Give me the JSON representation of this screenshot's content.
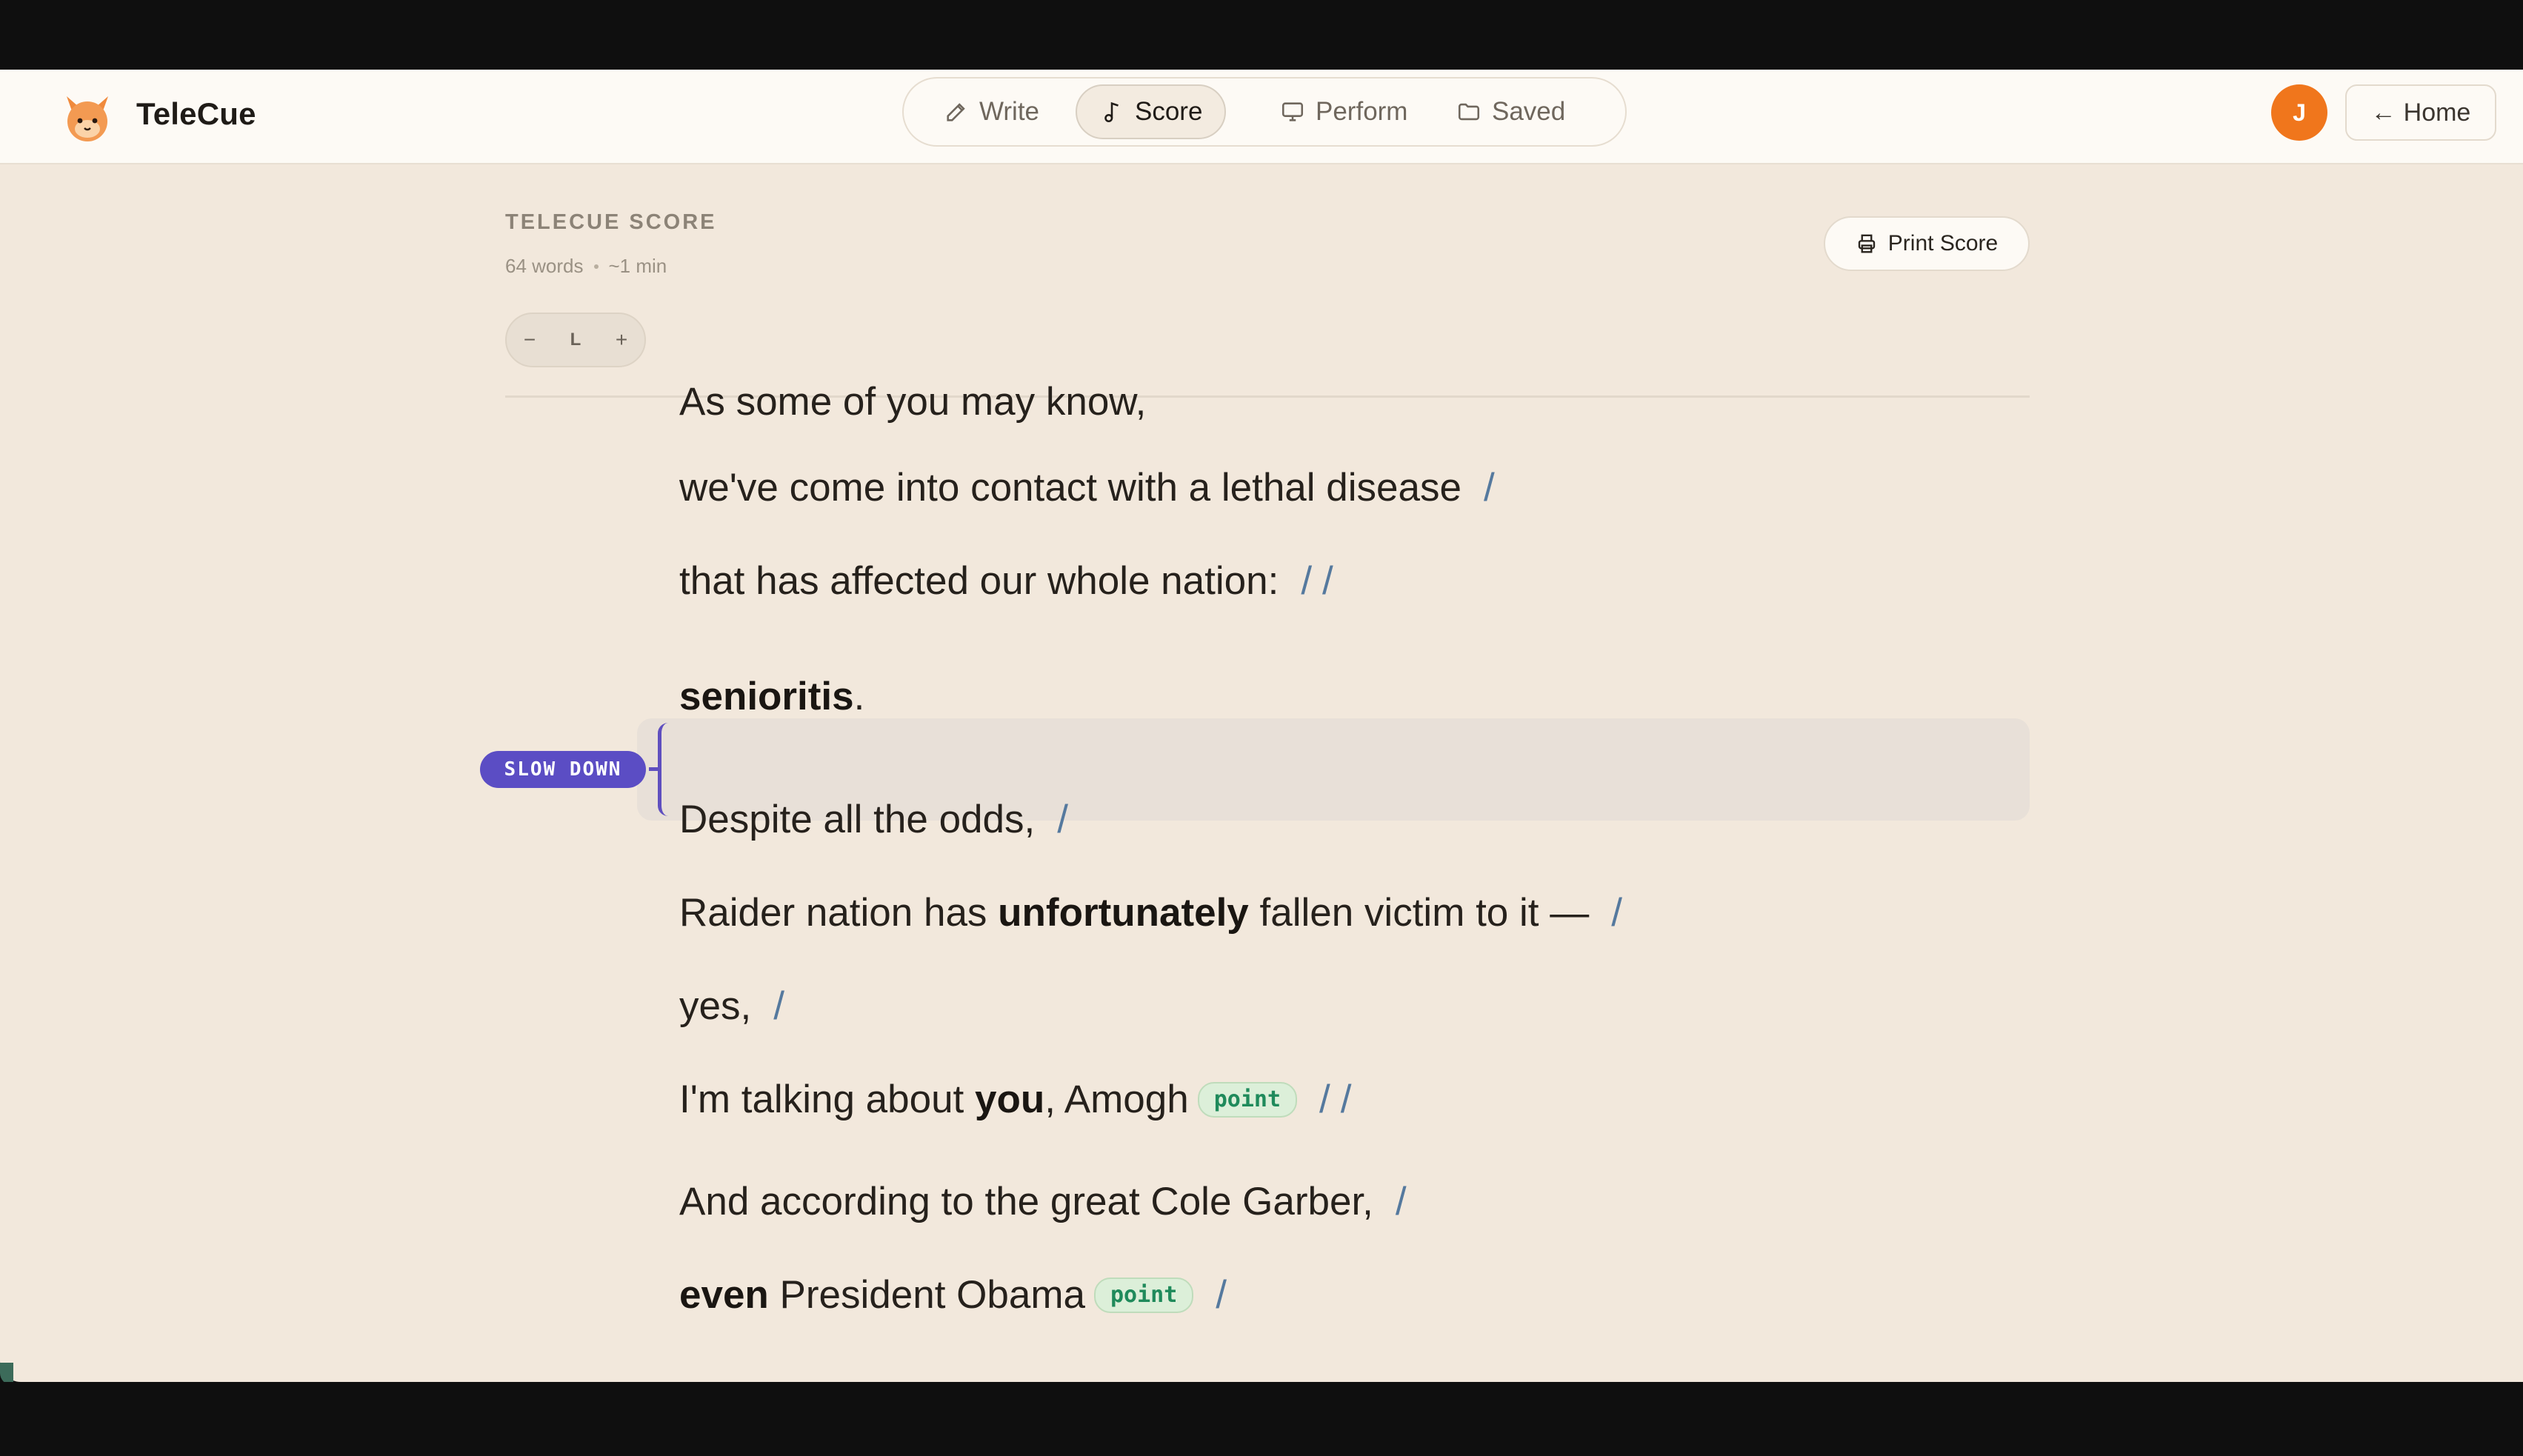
{
  "app": {
    "name": "TeleCue"
  },
  "nav": {
    "items": [
      {
        "label": "Write",
        "icon": "pencil-icon",
        "active": false
      },
      {
        "label": "Score",
        "icon": "music-note-icon",
        "active": true
      },
      {
        "label": "Perform",
        "icon": "monitor-icon",
        "active": false
      },
      {
        "label": "Saved",
        "icon": "folder-icon",
        "active": false
      }
    ]
  },
  "user": {
    "initial": "J"
  },
  "home_button": {
    "label": "Home"
  },
  "score": {
    "kicker": "TELECUE SCORE",
    "word_count": "64 words",
    "duration": "~1 min",
    "size_label": "L",
    "decrease": "−",
    "increase": "+",
    "print_label": "Print Score"
  },
  "lines": [
    {
      "segments": [
        {
          "t": "As some of you may know,",
          "b": false
        }
      ],
      "pause": ""
    },
    {
      "segments": [
        {
          "t": "we've come into contact with a lethal disease",
          "b": false
        }
      ],
      "pause": "/"
    },
    {
      "segments": [
        {
          "t": "that has affected our whole nation:",
          "b": false
        }
      ],
      "pause": "//"
    },
    {
      "segments": [
        {
          "t": "senioritis",
          "b": true
        },
        {
          "t": ".",
          "b": false
        }
      ],
      "pause": "",
      "cue": "SLOW DOWN"
    },
    {
      "segments": [
        {
          "t": "Despite all the odds,",
          "b": false
        }
      ],
      "pause": "/"
    },
    {
      "segments": [
        {
          "t": "Raider nation has ",
          "b": false
        },
        {
          "t": "unfortunately",
          "b": true
        },
        {
          "t": " fallen victim to it —",
          "b": false
        }
      ],
      "pause": "/"
    },
    {
      "segments": [
        {
          "t": "yes,",
          "b": false
        }
      ],
      "pause": "/"
    },
    {
      "segments": [
        {
          "t": "I'm talking about ",
          "b": false
        },
        {
          "t": "you",
          "b": true
        },
        {
          "t": ", Amogh",
          "b": false
        }
      ],
      "chip": "point",
      "pause": "//"
    },
    {
      "segments": [
        {
          "t": "And according to the great Cole Garber,",
          "b": false
        }
      ],
      "pause": "/"
    },
    {
      "segments": [
        {
          "t": "even",
          "b": true
        },
        {
          "t": " President Obama",
          "b": false
        }
      ],
      "chip": "point",
      "pause": "/"
    }
  ],
  "colors": {
    "accent": "#f0761c",
    "cue": "#5b4dc4",
    "pause": "#55799e",
    "chip": "#1f8a5b",
    "background": "#f2e8dc"
  }
}
